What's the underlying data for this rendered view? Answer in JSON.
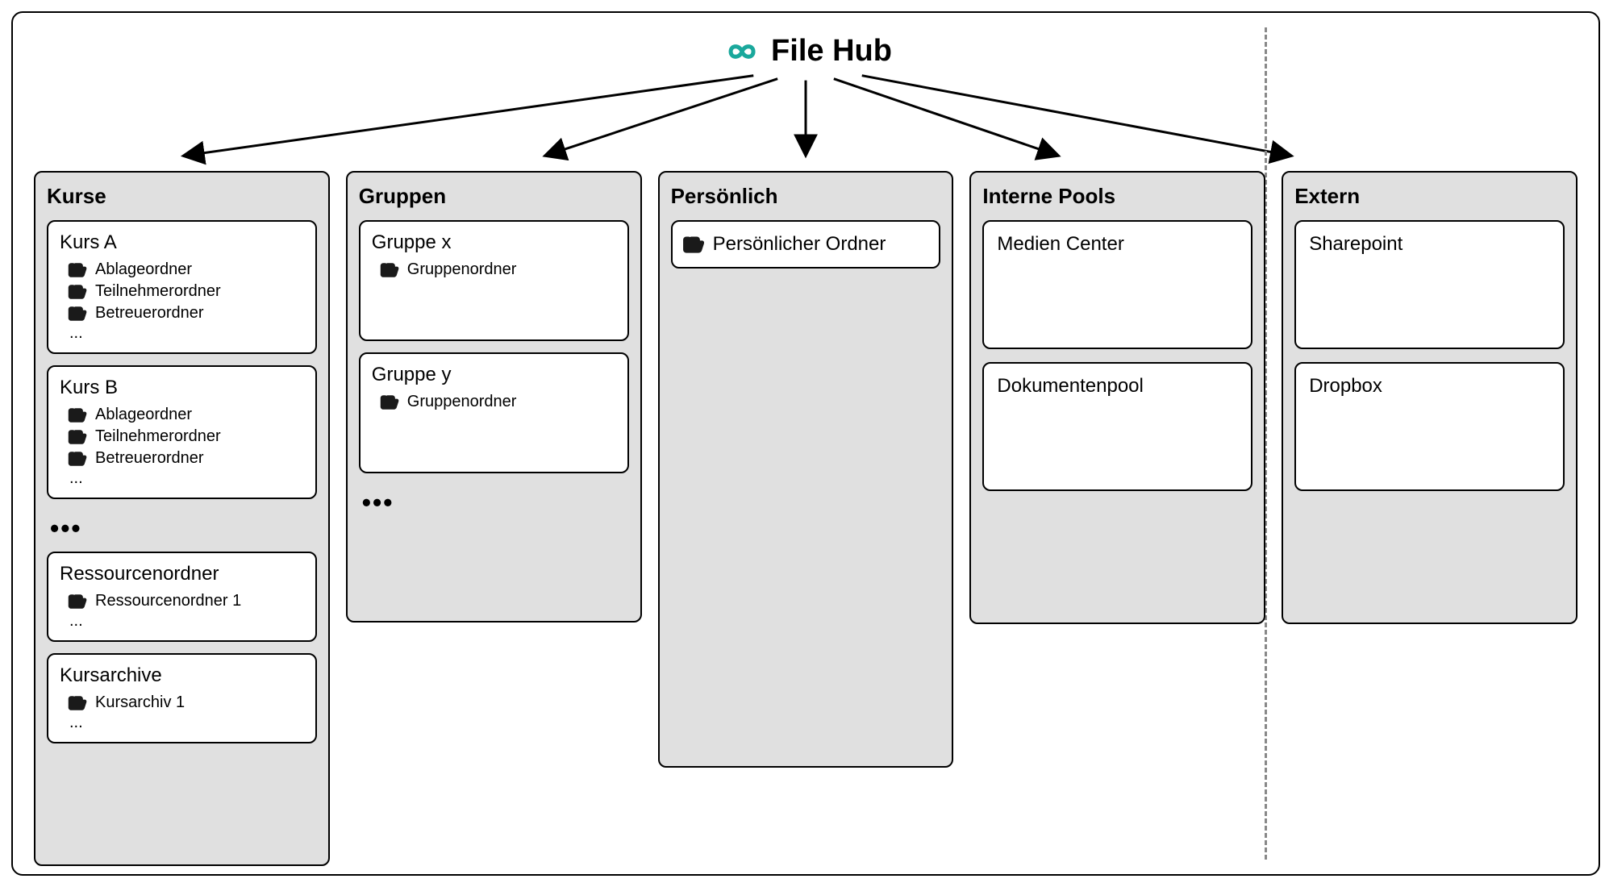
{
  "header": {
    "title": "File Hub"
  },
  "columns": {
    "kurse": {
      "title": "Kurse",
      "kurs_a": {
        "title": "Kurs A",
        "f1": "Ablageordner",
        "f2": "Teilnehmerordner",
        "f3": "Betreuerordner",
        "more": "..."
      },
      "kurs_b": {
        "title": "Kurs B",
        "f1": "Ablageordner",
        "f2": "Teilnehmerordner",
        "f3": "Betreuerordner",
        "more": "..."
      },
      "ellipsis": "•••",
      "ressourcen": {
        "title": "Ressourcenordner",
        "f1": "Ressourcenordner 1",
        "more": "..."
      },
      "kursarchive": {
        "title": "Kursarchive",
        "f1": "Kursarchiv 1",
        "more": "..."
      }
    },
    "gruppen": {
      "title": "Gruppen",
      "gruppe_x": {
        "title": "Gruppe x",
        "f1": "Gruppenordner"
      },
      "gruppe_y": {
        "title": "Gruppe y",
        "f1": "Gruppenordner"
      },
      "ellipsis": "•••"
    },
    "persoenlich": {
      "title": "Persönlich",
      "folder": "Persönlicher Ordner"
    },
    "intern": {
      "title": "Interne Pools",
      "item1": "Medien Center",
      "item2": "Dokumentenpool"
    },
    "extern": {
      "title": "Extern",
      "item1": "Sharepoint",
      "item2": "Dropbox"
    }
  }
}
